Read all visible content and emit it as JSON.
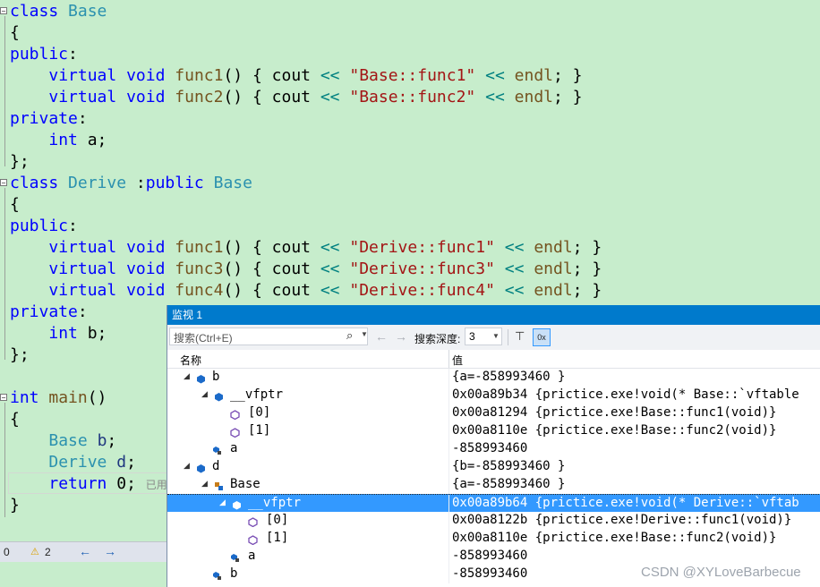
{
  "editor": {
    "lines": [
      [
        [
          "kw",
          "class"
        ],
        [
          "",
          " "
        ],
        [
          "ty",
          "Base"
        ]
      ],
      [
        [
          "",
          "{"
        ]
      ],
      [
        [
          "kw",
          "public"
        ],
        [
          "",
          ":"
        ]
      ],
      [
        [
          "",
          "    "
        ],
        [
          "kw",
          "virtual"
        ],
        [
          "",
          " "
        ],
        [
          "kw",
          "void"
        ],
        [
          "",
          " "
        ],
        [
          "fn",
          "func1"
        ],
        [
          "",
          "() { "
        ],
        [
          "",
          "cout"
        ],
        [
          "",
          " "
        ],
        [
          "op",
          "<<"
        ],
        [
          "",
          " "
        ],
        [
          "str",
          "\"Base::func1\""
        ],
        [
          "",
          " "
        ],
        [
          "op",
          "<<"
        ],
        [
          "",
          " "
        ],
        [
          "fn",
          "endl"
        ],
        [
          "",
          "; }"
        ]
      ],
      [
        [
          "",
          "    "
        ],
        [
          "kw",
          "virtual"
        ],
        [
          "",
          " "
        ],
        [
          "kw",
          "void"
        ],
        [
          "",
          " "
        ],
        [
          "fn",
          "func2"
        ],
        [
          "",
          "() { "
        ],
        [
          "",
          "cout"
        ],
        [
          "",
          " "
        ],
        [
          "op",
          "<<"
        ],
        [
          "",
          " "
        ],
        [
          "str",
          "\"Base::func2\""
        ],
        [
          "",
          " "
        ],
        [
          "op",
          "<<"
        ],
        [
          "",
          " "
        ],
        [
          "fn",
          "endl"
        ],
        [
          "",
          "; }"
        ]
      ],
      [
        [
          "kw",
          "private"
        ],
        [
          "",
          ":"
        ]
      ],
      [
        [
          "",
          "    "
        ],
        [
          "kw",
          "int"
        ],
        [
          "",
          " a;"
        ]
      ],
      [
        [
          "",
          "};"
        ]
      ],
      [
        [
          "kw",
          "class"
        ],
        [
          "",
          " "
        ],
        [
          "ty",
          "Derive"
        ],
        [
          "",
          " :"
        ],
        [
          "kw",
          "public"
        ],
        [
          "",
          " "
        ],
        [
          "ty",
          "Base"
        ]
      ],
      [
        [
          "",
          "{"
        ]
      ],
      [
        [
          "kw",
          "public"
        ],
        [
          "",
          ":"
        ]
      ],
      [
        [
          "",
          "    "
        ],
        [
          "kw",
          "virtual"
        ],
        [
          "",
          " "
        ],
        [
          "kw",
          "void"
        ],
        [
          "",
          " "
        ],
        [
          "fn",
          "func1"
        ],
        [
          "",
          "() { "
        ],
        [
          "",
          "cout"
        ],
        [
          "",
          " "
        ],
        [
          "op",
          "<<"
        ],
        [
          "",
          " "
        ],
        [
          "str",
          "\"Derive::func1\""
        ],
        [
          "",
          " "
        ],
        [
          "op",
          "<<"
        ],
        [
          "",
          " "
        ],
        [
          "fn",
          "endl"
        ],
        [
          "",
          "; }"
        ]
      ],
      [
        [
          "",
          "    "
        ],
        [
          "kw",
          "virtual"
        ],
        [
          "",
          " "
        ],
        [
          "kw",
          "void"
        ],
        [
          "",
          " "
        ],
        [
          "fn",
          "func3"
        ],
        [
          "",
          "() { "
        ],
        [
          "",
          "cout"
        ],
        [
          "",
          " "
        ],
        [
          "op",
          "<<"
        ],
        [
          "",
          " "
        ],
        [
          "str",
          "\"Derive::func3\""
        ],
        [
          "",
          " "
        ],
        [
          "op",
          "<<"
        ],
        [
          "",
          " "
        ],
        [
          "fn",
          "endl"
        ],
        [
          "",
          "; }"
        ]
      ],
      [
        [
          "",
          "    "
        ],
        [
          "kw",
          "virtual"
        ],
        [
          "",
          " "
        ],
        [
          "kw",
          "void"
        ],
        [
          "",
          " "
        ],
        [
          "fn",
          "func4"
        ],
        [
          "",
          "() { "
        ],
        [
          "",
          "cout"
        ],
        [
          "",
          " "
        ],
        [
          "op",
          "<<"
        ],
        [
          "",
          " "
        ],
        [
          "str",
          "\"Derive::func4\""
        ],
        [
          "",
          " "
        ],
        [
          "op",
          "<<"
        ],
        [
          "",
          " "
        ],
        [
          "fn",
          "endl"
        ],
        [
          "",
          "; }"
        ]
      ],
      [
        [
          "kw",
          "private"
        ],
        [
          "",
          ":"
        ]
      ],
      [
        [
          "",
          "    "
        ],
        [
          "kw",
          "int"
        ],
        [
          "",
          " b;"
        ]
      ],
      [
        [
          "",
          "};"
        ]
      ],
      [
        [
          "",
          ""
        ]
      ],
      [
        [
          "kw",
          "int"
        ],
        [
          "",
          " "
        ],
        [
          "fn",
          "main"
        ],
        [
          "",
          "()"
        ]
      ],
      [
        [
          "",
          "{"
        ]
      ],
      [
        [
          "",
          "    "
        ],
        [
          "ty",
          "Base"
        ],
        [
          "",
          " "
        ],
        [
          "var",
          "b"
        ],
        [
          "",
          ";"
        ]
      ],
      [
        [
          "",
          "    "
        ],
        [
          "ty",
          "Derive"
        ],
        [
          "",
          " "
        ],
        [
          "var",
          "d"
        ],
        [
          "",
          ";"
        ]
      ],
      [
        [
          "",
          "    "
        ],
        [
          "kw",
          "return"
        ],
        [
          "",
          " 0; "
        ],
        [
          "hint",
          "已用"
        ]
      ],
      [
        [
          "",
          "}"
        ]
      ]
    ]
  },
  "status": {
    "first": "0",
    "warnings": "2",
    "back_arrow": "←",
    "fwd_arrow": "→"
  },
  "watch": {
    "title": "监视 1",
    "search_placeholder": "搜索(Ctrl+E)",
    "depth_label": "搜索深度:",
    "depth_value": "3",
    "col_name": "名称",
    "col_value": "值",
    "rows": [
      {
        "name": "b",
        "value": "{a=-858993460 }"
      },
      {
        "name": "__vfptr",
        "value": "0x00a89b34 {prictice.exe!void(* Base::`vftable"
      },
      {
        "name": "[0]",
        "value": "0x00a81294 {prictice.exe!Base::func1(void)}"
      },
      {
        "name": "[1]",
        "value": "0x00a8110e {prictice.exe!Base::func2(void)}"
      },
      {
        "name": "a",
        "value": "-858993460"
      },
      {
        "name": "d",
        "value": "{b=-858993460 }"
      },
      {
        "name": "Base",
        "value": "{a=-858993460 }"
      },
      {
        "name": "__vfptr",
        "value": "0x00a89b64 {prictice.exe!void(* Derive::`vftab"
      },
      {
        "name": "[0]",
        "value": "0x00a8122b {prictice.exe!Derive::func1(void)}"
      },
      {
        "name": "[1]",
        "value": "0x00a8110e {prictice.exe!Base::func2(void)}"
      },
      {
        "name": "a",
        "value": "-858993460"
      },
      {
        "name": "b",
        "value": "-858993460"
      }
    ]
  },
  "watermark": "CSDN @XYLoveBarbecue"
}
